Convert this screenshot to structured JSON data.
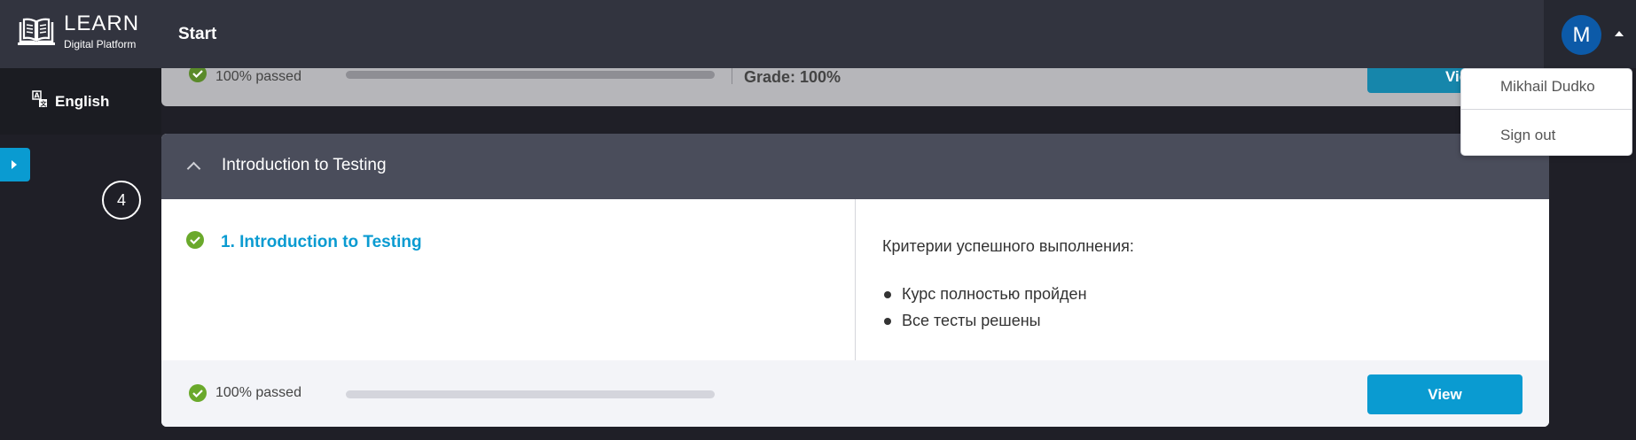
{
  "header": {
    "logo_title": "LEARN",
    "logo_subtitle": "Digital Platform",
    "nav_start": "Start",
    "avatar_initial": "M"
  },
  "sidebar": {
    "language": "English",
    "step_number": "4"
  },
  "previous_card": {
    "passed_text": "100% passed",
    "grade_text": "Grade: 100%",
    "view_label": "View"
  },
  "card": {
    "title": "Introduction to Testing",
    "lesson_label": "1. Introduction to Testing",
    "criteria_title": "Критерии успешного выполнения:",
    "criteria": [
      "Курс полностью пройден",
      "Все тесты решены"
    ],
    "passed_text": "100% passed",
    "progress": 1.0,
    "view_label": "View"
  },
  "user_menu": {
    "name": "Mikhail Dudko",
    "sign_out": "Sign out"
  },
  "colors": {
    "accent": "#0a9bd1",
    "check_green": "#6aa92b",
    "header_bg": "#32343f",
    "card_head_bg": "#4a4d5b"
  },
  "icons": [
    "book-logo-icon",
    "translate-icon",
    "chevron-right-icon",
    "chevron-up-icon",
    "check-circle-icon",
    "caret-up-icon"
  ]
}
